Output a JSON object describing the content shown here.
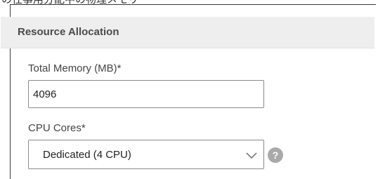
{
  "top_strip": {
    "text": "の仕事用分配中の物理メモリ"
  },
  "section": {
    "title": "Resource Allocation"
  },
  "memory": {
    "label": "Total Memory (MB)*",
    "value": "4096"
  },
  "cpu": {
    "label": "CPU Cores*",
    "selected": "Dedicated (4 CPU)"
  },
  "icons": {
    "dropdown": "chevron-down-icon",
    "help": "help-icon"
  },
  "colors": {
    "header_bg": "#eeeeee",
    "border": "#8a8a8a",
    "help_icon_bg": "#a9a9a9"
  }
}
